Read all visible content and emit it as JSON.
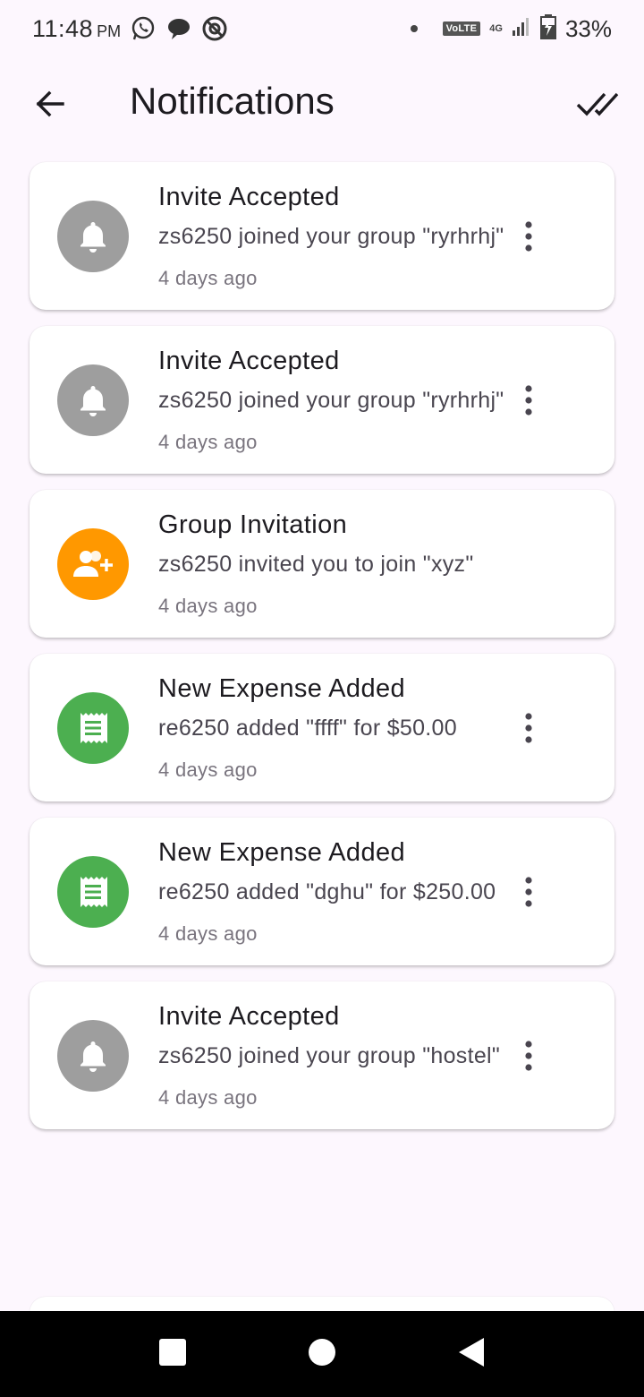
{
  "status_bar": {
    "time": "11:48",
    "ampm": "PM",
    "network_badge": "VoLTE",
    "network_type": "4G",
    "battery": "33%",
    "icons": [
      "whatsapp-icon",
      "chat-bubble-icon",
      "vpn-icon",
      "signal-icon",
      "battery-charging-icon"
    ]
  },
  "app_bar": {
    "title": "Notifications",
    "back_icon": "arrow-back-icon",
    "action_icon": "done-all-icon"
  },
  "colors": {
    "background": "#fdf7fe",
    "gray_avatar": "#9e9e9e",
    "orange_avatar": "#ff9800",
    "green_avatar": "#4caf50"
  },
  "notifications": [
    {
      "title": "Invite Accepted",
      "body": "zs6250 joined your group \"ryrhrhj\"",
      "time": "4 days ago",
      "icon": "bell-icon",
      "color": "#9e9e9e",
      "has_menu": true
    },
    {
      "title": "Invite Accepted",
      "body": "zs6250 joined your group \"ryrhrhj\"",
      "time": "4 days ago",
      "icon": "bell-icon",
      "color": "#9e9e9e",
      "has_menu": true
    },
    {
      "title": "Group Invitation",
      "body": "zs6250 invited you to join \"xyz\"",
      "time": "4 days ago",
      "icon": "group-add-icon",
      "color": "#ff9800",
      "has_menu": false
    },
    {
      "title": "New Expense Added",
      "body": "re6250 added \"ffff\" for $50.00",
      "time": "4 days ago",
      "icon": "receipt-icon",
      "color": "#4caf50",
      "has_menu": true
    },
    {
      "title": "New Expense Added",
      "body": "re6250 added \"dghu\" for $250.00",
      "time": "4 days ago",
      "icon": "receipt-icon",
      "color": "#4caf50",
      "has_menu": true
    },
    {
      "title": "Invite Accepted",
      "body": "zs6250 joined your group \"hostel\"",
      "time": "4 days ago",
      "icon": "bell-icon",
      "color": "#9e9e9e",
      "has_menu": true
    }
  ],
  "nav_bar": {
    "icons": [
      "recents-square-icon",
      "home-circle-icon",
      "back-triangle-icon"
    ]
  }
}
